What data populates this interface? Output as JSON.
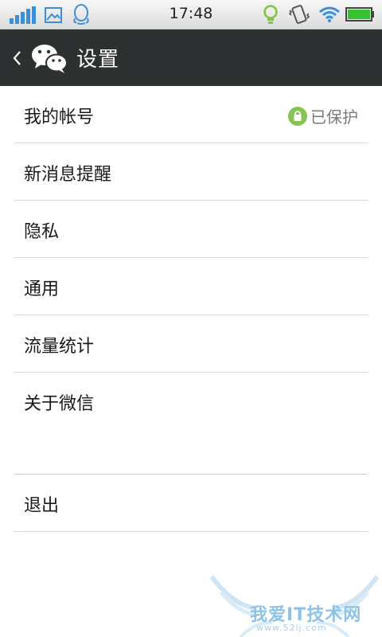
{
  "status_bar": {
    "time": "17:48",
    "icons": [
      "signal-icon",
      "gallery-icon",
      "qq-icon",
      "bulb-icon",
      "vibrate-icon",
      "wifi-icon",
      "battery-icon"
    ],
    "accent_blue": "#3b8fd8",
    "battery_green": "#35c130"
  },
  "title_bar": {
    "title": "设置",
    "background": "#2e3132"
  },
  "menu": {
    "items": [
      {
        "label": "我的帐号",
        "status": "已保护"
      },
      {
        "label": "新消息提醒"
      },
      {
        "label": "隐私"
      },
      {
        "label": "通用"
      },
      {
        "label": "流量统计"
      },
      {
        "label": "关于微信"
      }
    ],
    "logout_label": "退出"
  },
  "watermark": {
    "text": "我爱IT技术网",
    "url": "www.52ij.com"
  }
}
